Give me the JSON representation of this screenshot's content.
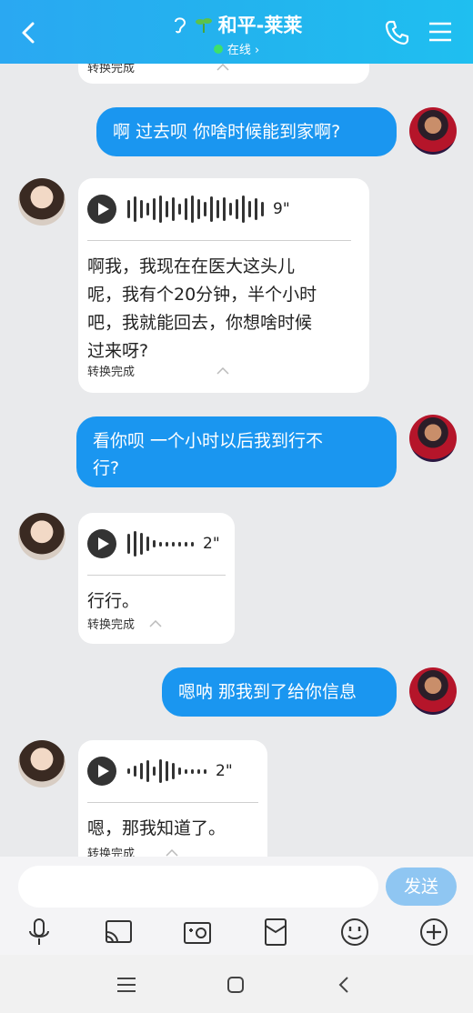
{
  "header": {
    "title": "和平-莱莱",
    "status": "在线 ›",
    "accent": "#23b3ee"
  },
  "messages": [
    {
      "type": "voice-in-partial",
      "convert_label": "转换完成"
    },
    {
      "type": "text-out",
      "text": "啊 过去呗 你啥时候能到家啊?"
    },
    {
      "type": "voice-in",
      "duration": "9\"",
      "transcript": "啊我，我现在在医大这头儿呢，我有个20分钟，半个小时吧，我就能回去，你想啥时候过来呀?",
      "transcript_lines": [
        "啊我，我现在在医大这头儿",
        "呢，我有个20分钟，半个小时",
        "吧，我就能回去，你想啥时候",
        "过来呀?"
      ],
      "convert_label": "转换完成"
    },
    {
      "type": "text-out",
      "text_lines": [
        "看你呗 一个小时以后我到行不",
        "行?"
      ]
    },
    {
      "type": "voice-in",
      "duration": "2\"",
      "transcript": "行行。",
      "convert_label": "转换完成"
    },
    {
      "type": "text-out",
      "text": "嗯呐 那我到了给你信息"
    },
    {
      "type": "voice-in",
      "duration": "2\"",
      "transcript": "嗯，那我知道了。",
      "convert_label": "转换完成"
    }
  ],
  "input": {
    "placeholder": "",
    "send_label": "发送"
  },
  "toolbar": [
    "mic-icon",
    "cast-icon",
    "image-icon",
    "red-packet-icon",
    "emoji-icon",
    "plus-icon"
  ],
  "navbar": [
    "menu-icon",
    "home-icon",
    "back-icon"
  ],
  "colors": {
    "bubble_out": "#1a96f0",
    "bubble_in": "#ffffff",
    "send_disabled": "#8fc6f2"
  }
}
